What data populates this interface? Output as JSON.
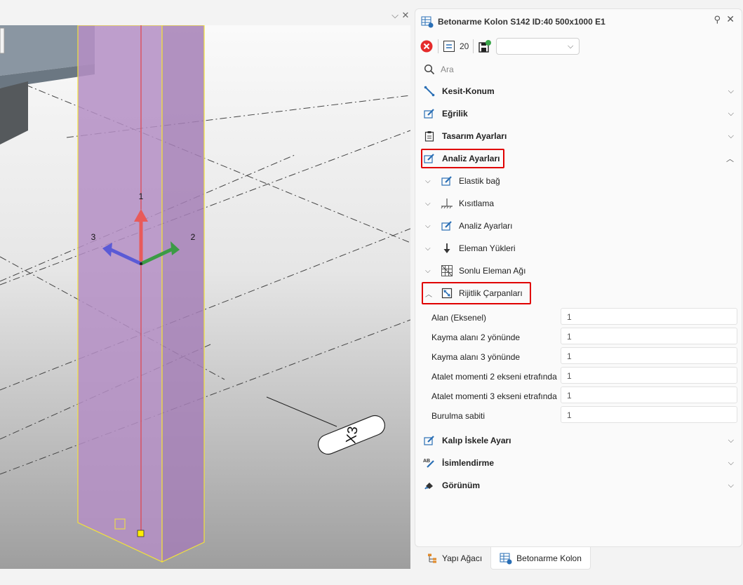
{
  "panel": {
    "title": "Betonarme Kolon S142 ID:40 500x1000 E1",
    "toolbar": {
      "count_value": "20",
      "dropdown_value": ""
    },
    "search_placeholder": "Ara",
    "sections": {
      "kesit_konum": "Kesit-Konum",
      "egrilik": "Eğrilik",
      "tasarim": "Tasarım Ayarları",
      "analiz": "Analiz Ayarları",
      "kalip": "Kalıp İskele Ayarı",
      "isimlendirme": "İsimlendirme",
      "gorunum": "Görünüm"
    },
    "analysis_subsections": {
      "elastik": "Elastik bağ",
      "kisitlama": "Kısıtlama",
      "analiz": "Analiz Ayarları",
      "eleman_yukleri": "Eleman Yükleri",
      "sonlu": "Sonlu Eleman Ağı",
      "rijitlik": "Rijitlik Çarpanları"
    },
    "properties": [
      {
        "label": "Alan (Eksenel)",
        "value": "1"
      },
      {
        "label": "Kayma alanı 2 yönünde",
        "value": "1"
      },
      {
        "label": "Kayma alanı 3 yönünde",
        "value": "1"
      },
      {
        "label": "Atalet momenti 2 ekseni etrafında",
        "value": "1"
      },
      {
        "label": "Atalet momenti 3 ekseni etrafında",
        "value": "1"
      },
      {
        "label": "Burulma sabiti",
        "value": "1"
      }
    ]
  },
  "bottom_tabs": {
    "tab1": "Yapı Ağacı",
    "tab2": "Betonarme Kolon"
  },
  "viewport": {
    "axis_labels": {
      "axis1": "1",
      "axis2": "2",
      "axis3": "3"
    },
    "grid_bubble": "X3"
  },
  "colors": {
    "highlight": "#e00000",
    "column_fill": "#b48ec4",
    "column_outline": "#f2e23a",
    "axis1": "#e85a5a",
    "axis2": "#3c9b45",
    "axis3": "#5a5ad6"
  }
}
